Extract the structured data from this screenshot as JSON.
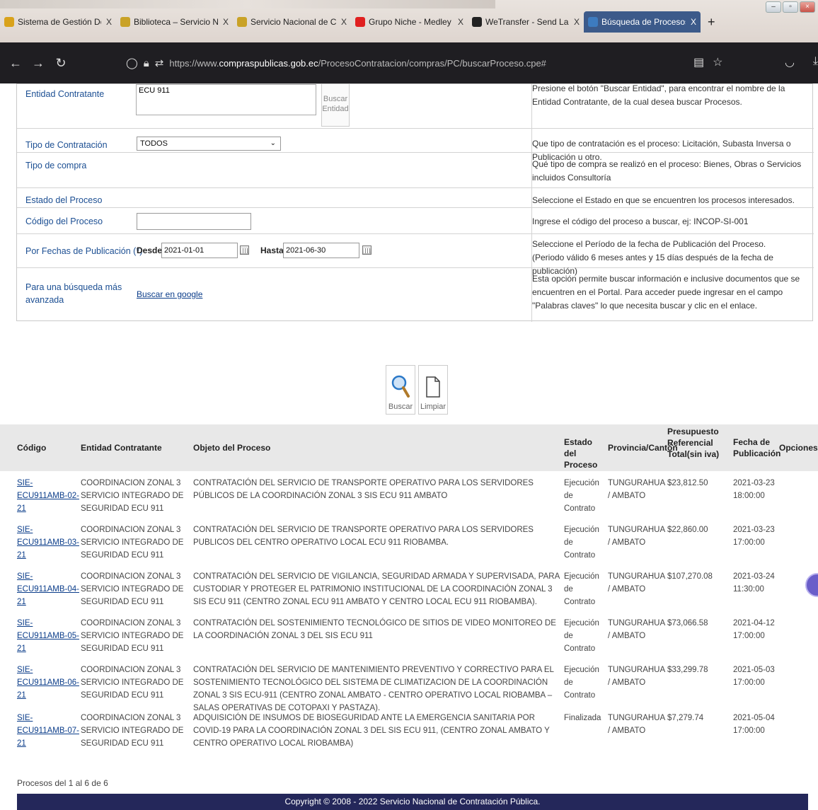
{
  "browser": {
    "tabs": [
      {
        "label": "Sistema de Gestión Documenta",
        "fav_color": "#d9a21b"
      },
      {
        "label": "Biblioteca – Servicio Nacional d",
        "fav_color": "#c9a227"
      },
      {
        "label": "Servicio Nacional de Contratac",
        "fav_color": "#c9a227"
      },
      {
        "label": "Grupo Niche - Medley - Un Cas",
        "fav_color": "#e02020"
      },
      {
        "label": "WeTransfer - Send Large Files &",
        "fav_color": "#222222"
      },
      {
        "label": "Búsqueda de Procesos de Contr",
        "fav_color": "#3d7bbf",
        "active": true
      }
    ],
    "close_glyph": "X",
    "newtab_glyph": "+",
    "url_prefix": "https://www.",
    "url_domain": "compraspublicas.gob.ec",
    "url_path": "/ProcesoContratacion/compras/PC/buscarProceso.cpe#"
  },
  "form": {
    "entidad": {
      "label": "Entidad Contratante",
      "value": "ECU 911",
      "button_label_1": "Buscar",
      "button_label_2": "Entidad",
      "help": "Presione el botón \"Buscar Entidad\", para encontrar el nombre de la Entidad Contratante, de la cual desea buscar Procesos."
    },
    "tipo_contratacion": {
      "label": "Tipo de Contratación",
      "value": "TODOS",
      "help": "Que tipo de contratación es el proceso: Licitación, Subasta Inversa o Publicación u otro."
    },
    "tipo_compra": {
      "label": "Tipo de compra",
      "help": "Qué tipo de compra se realizó en el proceso: Bienes, Obras o Servicios incluidos Consultoría"
    },
    "estado": {
      "label": "Estado del Proceso",
      "help": "Seleccione el Estado en que se encuentren los procesos interesados."
    },
    "codigo": {
      "label": "Código del Proceso",
      "value": "",
      "help": "Ingrese el código del proceso a buscar, ej: INCOP-SI-001"
    },
    "fechas": {
      "label": "Por Fechas de Publicación (*)",
      "desde_label": "Desde:",
      "desde_value": "2021-01-01",
      "hasta_label": "Hasta:",
      "hasta_value": "2021-06-30",
      "help_1": "Seleccione el Período de la fecha de Publicación del Proceso.",
      "help_2": "(Periodo válido 6 meses antes y 15 días después de la fecha de publicación)"
    },
    "avanzada": {
      "label": "Para una búsqueda más avanzada",
      "link": "Buscar en google",
      "help": "Esta opción permite buscar información e inclusive documentos que se encuentren en el Portal. Para acceder puede ingresar en el campo \"Palabras claves\" lo que necesita buscar y clic en el enlace."
    }
  },
  "actions": {
    "search_label": "Buscar",
    "clear_label": "Limpiar"
  },
  "results": {
    "headers": {
      "codigo": "Código",
      "entidad": "Entidad Contratante",
      "objeto": "Objeto del Proceso",
      "estado": "Estado del Proceso",
      "provincia": "Provincia/Cantón",
      "presupuesto": "Presupuesto Referencial Total(sin iva)",
      "fecha": "Fecha de Publicación",
      "opciones": "Opciones"
    },
    "rows": [
      {
        "code_1": "SIE-",
        "code_2": "ECU911AMB-02-21",
        "entidad": "COORDINACION ZONAL 3 SERVICIO INTEGRADO DE SEGURIDAD ECU 911",
        "objeto": "CONTRATACIÓN DEL SERVICIO DE TRANSPORTE OPERATIVO PARA LOS SERVIDORES PÚBLICOS DE LA COORDINACIÓN ZONAL 3 SIS ECU 911 AMBATO",
        "estado": "Ejecución de Contrato",
        "provincia": "TUNGURAHUA / AMBATO",
        "presupuesto": "$23,812.50",
        "fecha_1": "2021-03-23",
        "fecha_2": "18:00:00"
      },
      {
        "code_1": "SIE-",
        "code_2": "ECU911AMB-03-21",
        "entidad": "COORDINACION ZONAL 3 SERVICIO INTEGRADO DE SEGURIDAD ECU 911",
        "objeto": "CONTRATACIÓN DEL SERVICIO DE TRANSPORTE OPERATIVO PARA LOS SERVIDORES PUBLICOS DEL CENTRO OPERATIVO LOCAL ECU 911 RIOBAMBA.",
        "estado": "Ejecución de Contrato",
        "provincia": "TUNGURAHUA / AMBATO",
        "presupuesto": "$22,860.00",
        "fecha_1": "2021-03-23",
        "fecha_2": "17:00:00"
      },
      {
        "code_1": "SIE-",
        "code_2": "ECU911AMB-04-21",
        "entidad": "COORDINACION ZONAL 3 SERVICIO INTEGRADO DE SEGURIDAD ECU 911",
        "objeto": "CONTRATACIÓN DEL SERVICIO DE VIGILANCIA, SEGURIDAD ARMADA Y SUPERVISADA, PARA CUSTODIAR Y PROTEGER EL PATRIMONIO INSTITUCIONAL DE LA COORDINACIÓN ZONAL 3 SIS ECU 911 (CENTRO ZONAL ECU 911 AMBATO Y CENTRO LOCAL ECU 911 RIOBAMBA).",
        "estado": "Ejecución de Contrato",
        "provincia": "TUNGURAHUA / AMBATO",
        "presupuesto": "$107,270.08",
        "fecha_1": "2021-03-24",
        "fecha_2": "11:30:00"
      },
      {
        "code_1": "SIE-",
        "code_2": "ECU911AMB-05-21",
        "entidad": "COORDINACION ZONAL 3 SERVICIO INTEGRADO DE SEGURIDAD ECU 911",
        "objeto": "CONTRATACIÓN DEL SOSTENIMIENTO TECNOLÓGICO DE SITIOS DE VIDEO MONITOREO DE LA COORDINACIÓN ZONAL 3 DEL SIS ECU 911",
        "estado": "Ejecución de Contrato",
        "provincia": "TUNGURAHUA / AMBATO",
        "presupuesto": "$73,066.58",
        "fecha_1": "2021-04-12",
        "fecha_2": "17:00:00"
      },
      {
        "code_1": "SIE-",
        "code_2": "ECU911AMB-06-21",
        "entidad": "COORDINACION ZONAL 3 SERVICIO INTEGRADO DE SEGURIDAD ECU 911",
        "objeto": "CONTRATACIÓN DEL SERVICIO DE MANTENIMIENTO PREVENTIVO Y CORRECTIVO PARA EL SOSTENIMIENTO TECNOLÓGICO DEL SISTEMA DE CLIMATIZACION DE LA COORDINACIÓN ZONAL 3 SIS ECU-911 (CENTRO ZONAL AMBATO - CENTRO OPERATIVO LOCAL RIOBAMBA – SALAS OPERATIVAS DE COTOPAXI Y PASTAZA).",
        "estado": "Ejecución de Contrato",
        "provincia": "TUNGURAHUA / AMBATO",
        "presupuesto": "$33,299.78",
        "fecha_1": "2021-05-03",
        "fecha_2": "17:00:00"
      },
      {
        "code_1": "SIE-",
        "code_2": "ECU911AMB-07-21",
        "entidad": "COORDINACION ZONAL 3 SERVICIO INTEGRADO DE SEGURIDAD ECU 911",
        "objeto": "ADQUISICIÓN DE INSUMOS DE BIOSEGURIDAD ANTE LA EMERGENCIA SANITARIA POR COVID-19 PARA LA COORDINACIÓN ZONAL 3 DEL SIS ECU 911, (CENTRO ZONAL AMBATO Y CENTRO OPERATIVO LOCAL RIOBAMBA)",
        "estado": "Finalizada",
        "provincia": "TUNGURAHUA / AMBATO",
        "presupuesto": "$7,279.74",
        "fecha_1": "2021-05-04",
        "fecha_2": "17:00:00"
      }
    ],
    "count_text": "Procesos del 1 al 6 de 6"
  },
  "footer": {
    "copyright": "Copyright © 2008 - 2022 Servicio Nacional de Contratación Pública."
  }
}
